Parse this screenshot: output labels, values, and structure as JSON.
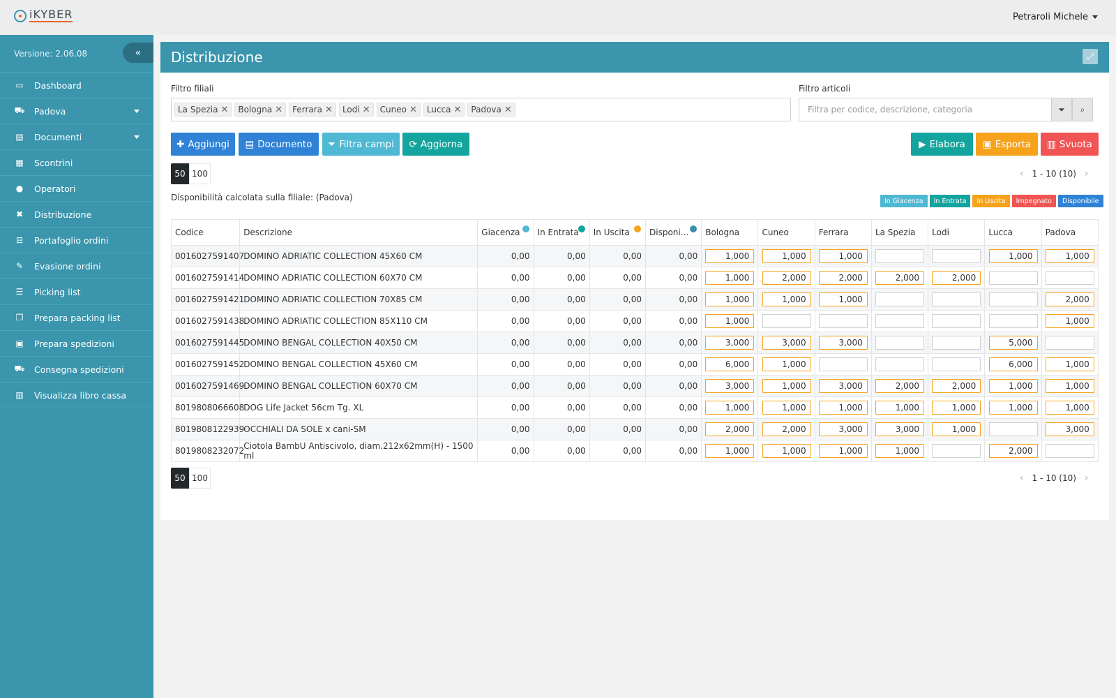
{
  "app": {
    "logo_text": "iKYBER",
    "user": "Petraroli Michele"
  },
  "sidebar": {
    "version": "Versione: 2.06.08",
    "items": [
      {
        "label": "Dashboard",
        "icon": "monitor-icon",
        "glyph": "▭"
      },
      {
        "label": "Padova",
        "icon": "cart-icon",
        "glyph": "⛟",
        "has_submenu": true
      },
      {
        "label": "Documenti",
        "icon": "file-icon",
        "glyph": "▤",
        "has_submenu": true
      },
      {
        "label": "Scontrini",
        "icon": "receipt-icon",
        "glyph": "▦"
      },
      {
        "label": "Operatori",
        "icon": "user-icon",
        "glyph": "●"
      },
      {
        "label": "Distribuzione",
        "icon": "distribute-icon",
        "glyph": "✖"
      },
      {
        "label": "Portafoglio ordini",
        "icon": "basket-icon",
        "glyph": "⊟"
      },
      {
        "label": "Evasione ordini",
        "icon": "edit-icon",
        "glyph": "✎"
      },
      {
        "label": "Picking list",
        "icon": "list-icon",
        "glyph": "☰"
      },
      {
        "label": "Prepara packing list",
        "icon": "copy-icon",
        "glyph": "❐"
      },
      {
        "label": "Prepara spedizioni",
        "icon": "gift-icon",
        "glyph": "▣"
      },
      {
        "label": "Consegna spedizioni",
        "icon": "truck-icon",
        "glyph": "⛟"
      },
      {
        "label": "Visualizza libro cassa",
        "icon": "book-icon",
        "glyph": "▥"
      }
    ]
  },
  "panel": {
    "title": "Distribuzione"
  },
  "filters": {
    "branches_label": "Filtro filiali",
    "branches": [
      "La Spezia",
      "Bologna",
      "Ferrara",
      "Lodi",
      "Cuneo",
      "Lucca",
      "Padova"
    ],
    "articles_label": "Filtro articoli",
    "articles_placeholder": "Filtra per codice, descrizione, categoria"
  },
  "toolbar": {
    "add": "Aggiungi",
    "document": "Documento",
    "filter_fields": "Filtra campi",
    "refresh": "Aggiorna",
    "process": "Elabora",
    "export": "Esporta",
    "empty": "Svuota"
  },
  "pagination": {
    "sizes": [
      "50",
      "100"
    ],
    "active_size": "50",
    "range": "1 - 10 (10)"
  },
  "availability_note": "Disponibilità calcolata sulla filiale: (Padova)",
  "legend": [
    {
      "label": "In Giacenza",
      "color": "#4fb8d3"
    },
    {
      "label": "In Entrata",
      "color": "#13a59d"
    },
    {
      "label": "In Uscita",
      "color": "#f7a21b"
    },
    {
      "label": "Impegnato",
      "color": "#f05454"
    },
    {
      "label": "Disponibile",
      "color": "#2f82d5"
    }
  ],
  "table": {
    "columns": [
      {
        "label": "Codice"
      },
      {
        "label": "Descrizione"
      },
      {
        "label": "Giacenza",
        "dot": "#4fb8d3"
      },
      {
        "label": "In Entrata",
        "dot": "#13a59d"
      },
      {
        "label": "In Uscita",
        "dot": "#f7a21b"
      },
      {
        "label": "Disponi...",
        "dot": "#3a8fae"
      },
      {
        "label": "Bologna"
      },
      {
        "label": "Cuneo"
      },
      {
        "label": "Ferrara"
      },
      {
        "label": "La Spezia"
      },
      {
        "label": "Lodi"
      },
      {
        "label": "Lucca"
      },
      {
        "label": "Padova"
      }
    ],
    "rows": [
      {
        "code": "0016027591407",
        "desc": "DOMINO ADRIATIC COLLECTION 45X60 CM",
        "stock": "0,00",
        "incoming": "0,00",
        "outgoing": "0,00",
        "available": "0,00",
        "qty": [
          "1,000",
          "1,000",
          "1,000",
          "",
          "",
          "1,000",
          "1,000"
        ]
      },
      {
        "code": "0016027591414",
        "desc": "DOMINO ADRIATIC COLLECTION 60X70 CM",
        "stock": "0,00",
        "incoming": "0,00",
        "outgoing": "0,00",
        "available": "0,00",
        "qty": [
          "1,000",
          "2,000",
          "2,000",
          "2,000",
          "2,000",
          "",
          ""
        ]
      },
      {
        "code": "0016027591421",
        "desc": "DOMINO ADRIATIC COLLECTION 70X85 CM",
        "stock": "0,00",
        "incoming": "0,00",
        "outgoing": "0,00",
        "available": "0,00",
        "qty": [
          "1,000",
          "1,000",
          "1,000",
          "",
          "",
          "",
          "2,000"
        ]
      },
      {
        "code": "0016027591438",
        "desc": "DOMINO ADRIATIC COLLECTION 85X110 CM",
        "stock": "0,00",
        "incoming": "0,00",
        "outgoing": "0,00",
        "available": "0,00",
        "qty": [
          "1,000",
          "",
          "",
          "",
          "",
          "",
          "1,000"
        ]
      },
      {
        "code": "0016027591445",
        "desc": "DOMINO BENGAL COLLECTION 40X50 CM",
        "stock": "0,00",
        "incoming": "0,00",
        "outgoing": "0,00",
        "available": "0,00",
        "qty": [
          "3,000",
          "3,000",
          "3,000",
          "",
          "",
          "5,000",
          ""
        ]
      },
      {
        "code": "0016027591452",
        "desc": "DOMINO BENGAL COLLECTION 45X60 CM",
        "stock": "0,00",
        "incoming": "0,00",
        "outgoing": "0,00",
        "available": "0,00",
        "qty": [
          "6,000",
          "1,000",
          "",
          "",
          "",
          "6,000",
          "1,000"
        ]
      },
      {
        "code": "0016027591469",
        "desc": "DOMINO BENGAL COLLECTION 60X70 CM",
        "stock": "0,00",
        "incoming": "0,00",
        "outgoing": "0,00",
        "available": "0,00",
        "qty": [
          "3,000",
          "1,000",
          "3,000",
          "2,000",
          "2,000",
          "1,000",
          "1,000"
        ]
      },
      {
        "code": "8019808066608",
        "desc": "DOG Life Jacket 56cm Tg. XL",
        "stock": "0,00",
        "incoming": "0,00",
        "outgoing": "0,00",
        "available": "0,00",
        "qty": [
          "1,000",
          "1,000",
          "1,000",
          "1,000",
          "1,000",
          "1,000",
          "1,000"
        ]
      },
      {
        "code": "8019808122939",
        "desc": "OCCHIALI DA SOLE x cani-SM",
        "stock": "0,00",
        "incoming": "0,00",
        "outgoing": "0,00",
        "available": "0,00",
        "qty": [
          "2,000",
          "2,000",
          "3,000",
          "3,000",
          "1,000",
          "",
          "3,000"
        ]
      },
      {
        "code": "8019808232072",
        "desc": "Ciotola BambU Antiscivolo, diam.212x62mm(H) - 1500 ml",
        "stock": "0,00",
        "incoming": "0,00",
        "outgoing": "0,00",
        "available": "0,00",
        "qty": [
          "1,000",
          "1,000",
          "1,000",
          "1,000",
          "",
          "2,000",
          ""
        ]
      }
    ]
  }
}
